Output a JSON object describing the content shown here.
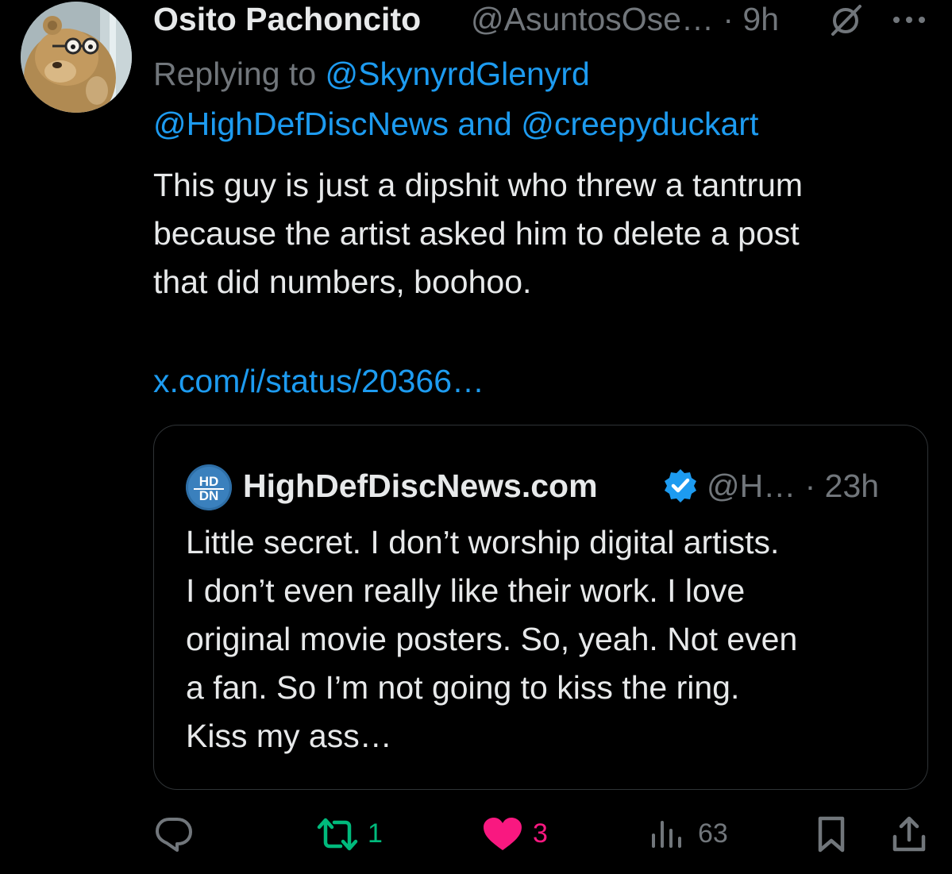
{
  "tweet": {
    "author": {
      "display_name": "Osito Pachoncito",
      "handle_time": "@AsuntosOse… · 9h"
    },
    "replying": {
      "prefix": "Replying to",
      "mention_1": "@SkynyrdGlenyrd",
      "mention_2": "@HighDefDiscNews",
      "conjunction": "and",
      "mention_3": "@creepyduckart"
    },
    "text_lines": [
      "This guy is just a dipshit who threw a tantrum",
      "because the artist asked him to delete a post",
      "that did numbers, boohoo."
    ],
    "link": "x.com/i/status/20366…",
    "icons": {
      "grok": "grok-icon",
      "more": "more-icon"
    }
  },
  "quoted": {
    "avatar_text": "HD DN",
    "display_name": "HighDefDiscNews.com",
    "meta": "@H… · 23h",
    "verified_color": "#1d9bf0",
    "text_lines": [
      "Little secret. I don’t worship digital artists.",
      "I don’t even really like their work. I love",
      "original movie posters. So, yeah. Not even",
      "a fan. So I’m not going to kiss the ring.",
      "Kiss my ass…"
    ]
  },
  "actions": {
    "reply_icon": "reply-icon",
    "retweet_count": "1",
    "like_count": "3",
    "views_count": "63",
    "bookmark_icon": "bookmark-icon",
    "share_icon": "share-icon"
  },
  "colors": {
    "background": "#000000",
    "text": "#e7e9ea",
    "secondary": "#71767b",
    "link": "#1d9bf0",
    "retweet": "#00ba7c",
    "like": "#f91880"
  }
}
